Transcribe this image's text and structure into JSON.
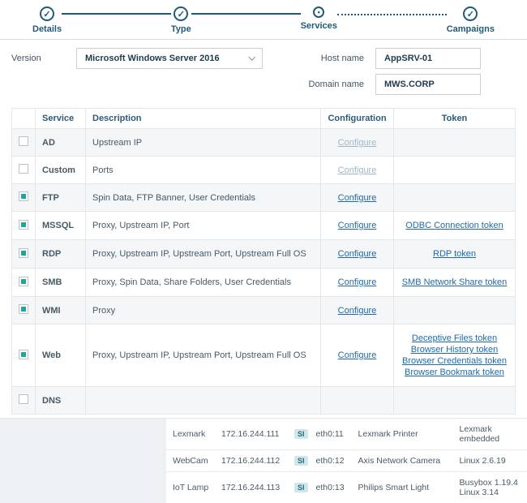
{
  "stepper": {
    "steps": [
      {
        "label": "Details"
      },
      {
        "label": "Type"
      },
      {
        "label": "Services"
      },
      {
        "label": "Campaigns"
      }
    ]
  },
  "form": {
    "version_label": "Version",
    "version_value": "Microsoft Windows Server 2016",
    "hostname_label": "Host name",
    "hostname_value": "AppSRV-01",
    "domain_label": "Domain name",
    "domain_value": "MWS.CORP"
  },
  "services_table": {
    "headers": {
      "service": "Service",
      "description": "Description",
      "configuration": "Configuration",
      "token": "Token"
    },
    "configure_label": "Configure",
    "rows": [
      {
        "checked": false,
        "name": "AD",
        "desc": "Upstream IP",
        "conf_enabled": false,
        "tokens": []
      },
      {
        "checked": false,
        "name": "Custom",
        "desc": "Ports",
        "conf_enabled": false,
        "tokens": []
      },
      {
        "checked": true,
        "name": "FTP",
        "desc": "Spin Data, FTP Banner, User Credentials",
        "conf_enabled": true,
        "tokens": []
      },
      {
        "checked": true,
        "name": "MSSQL",
        "desc": "Proxy, Upstream IP, Port",
        "conf_enabled": true,
        "tokens": [
          "ODBC Connection token"
        ]
      },
      {
        "checked": true,
        "name": "RDP",
        "desc": "Proxy, Upstream IP, Upstream Port, Upstream Full OS",
        "conf_enabled": true,
        "tokens": [
          "RDP token"
        ]
      },
      {
        "checked": true,
        "name": "SMB",
        "desc": "Proxy, Spin Data, Share Folders, User Credentials",
        "conf_enabled": true,
        "tokens": [
          "SMB Network Share token"
        ]
      },
      {
        "checked": true,
        "name": "WMI",
        "desc": "Proxy",
        "conf_enabled": true,
        "tokens": []
      },
      {
        "checked": true,
        "name": "Web",
        "desc": "Proxy, Upstream IP, Upstream Port, Upstream Full OS",
        "conf_enabled": true,
        "tokens": [
          "Deceptive Files token",
          "Browser History token",
          "Browser Credentials token",
          "Browser Bookmark token"
        ]
      },
      {
        "checked": false,
        "name": "DNS",
        "desc": "",
        "conf_enabled": false,
        "conf_hidden": true,
        "tokens": []
      }
    ]
  },
  "devices": {
    "badge": "SI",
    "rows": [
      {
        "name": "Lexmark",
        "ip": "172.16.244.111",
        "iface": "eth0:11",
        "model": "Lexmark Printer",
        "os": "Lexmark embedded"
      },
      {
        "name": "WebCam",
        "ip": "172.16.244.112",
        "iface": "eth0:12",
        "model": "Axis Network Camera",
        "os": "Linux 2.6.19"
      },
      {
        "name": "IoT Lamp",
        "ip": "172.16.244.113",
        "iface": "eth0:13",
        "model": "Philips Smart Light",
        "os": "Busybox 1.19.4 Linux 3.14"
      }
    ]
  }
}
